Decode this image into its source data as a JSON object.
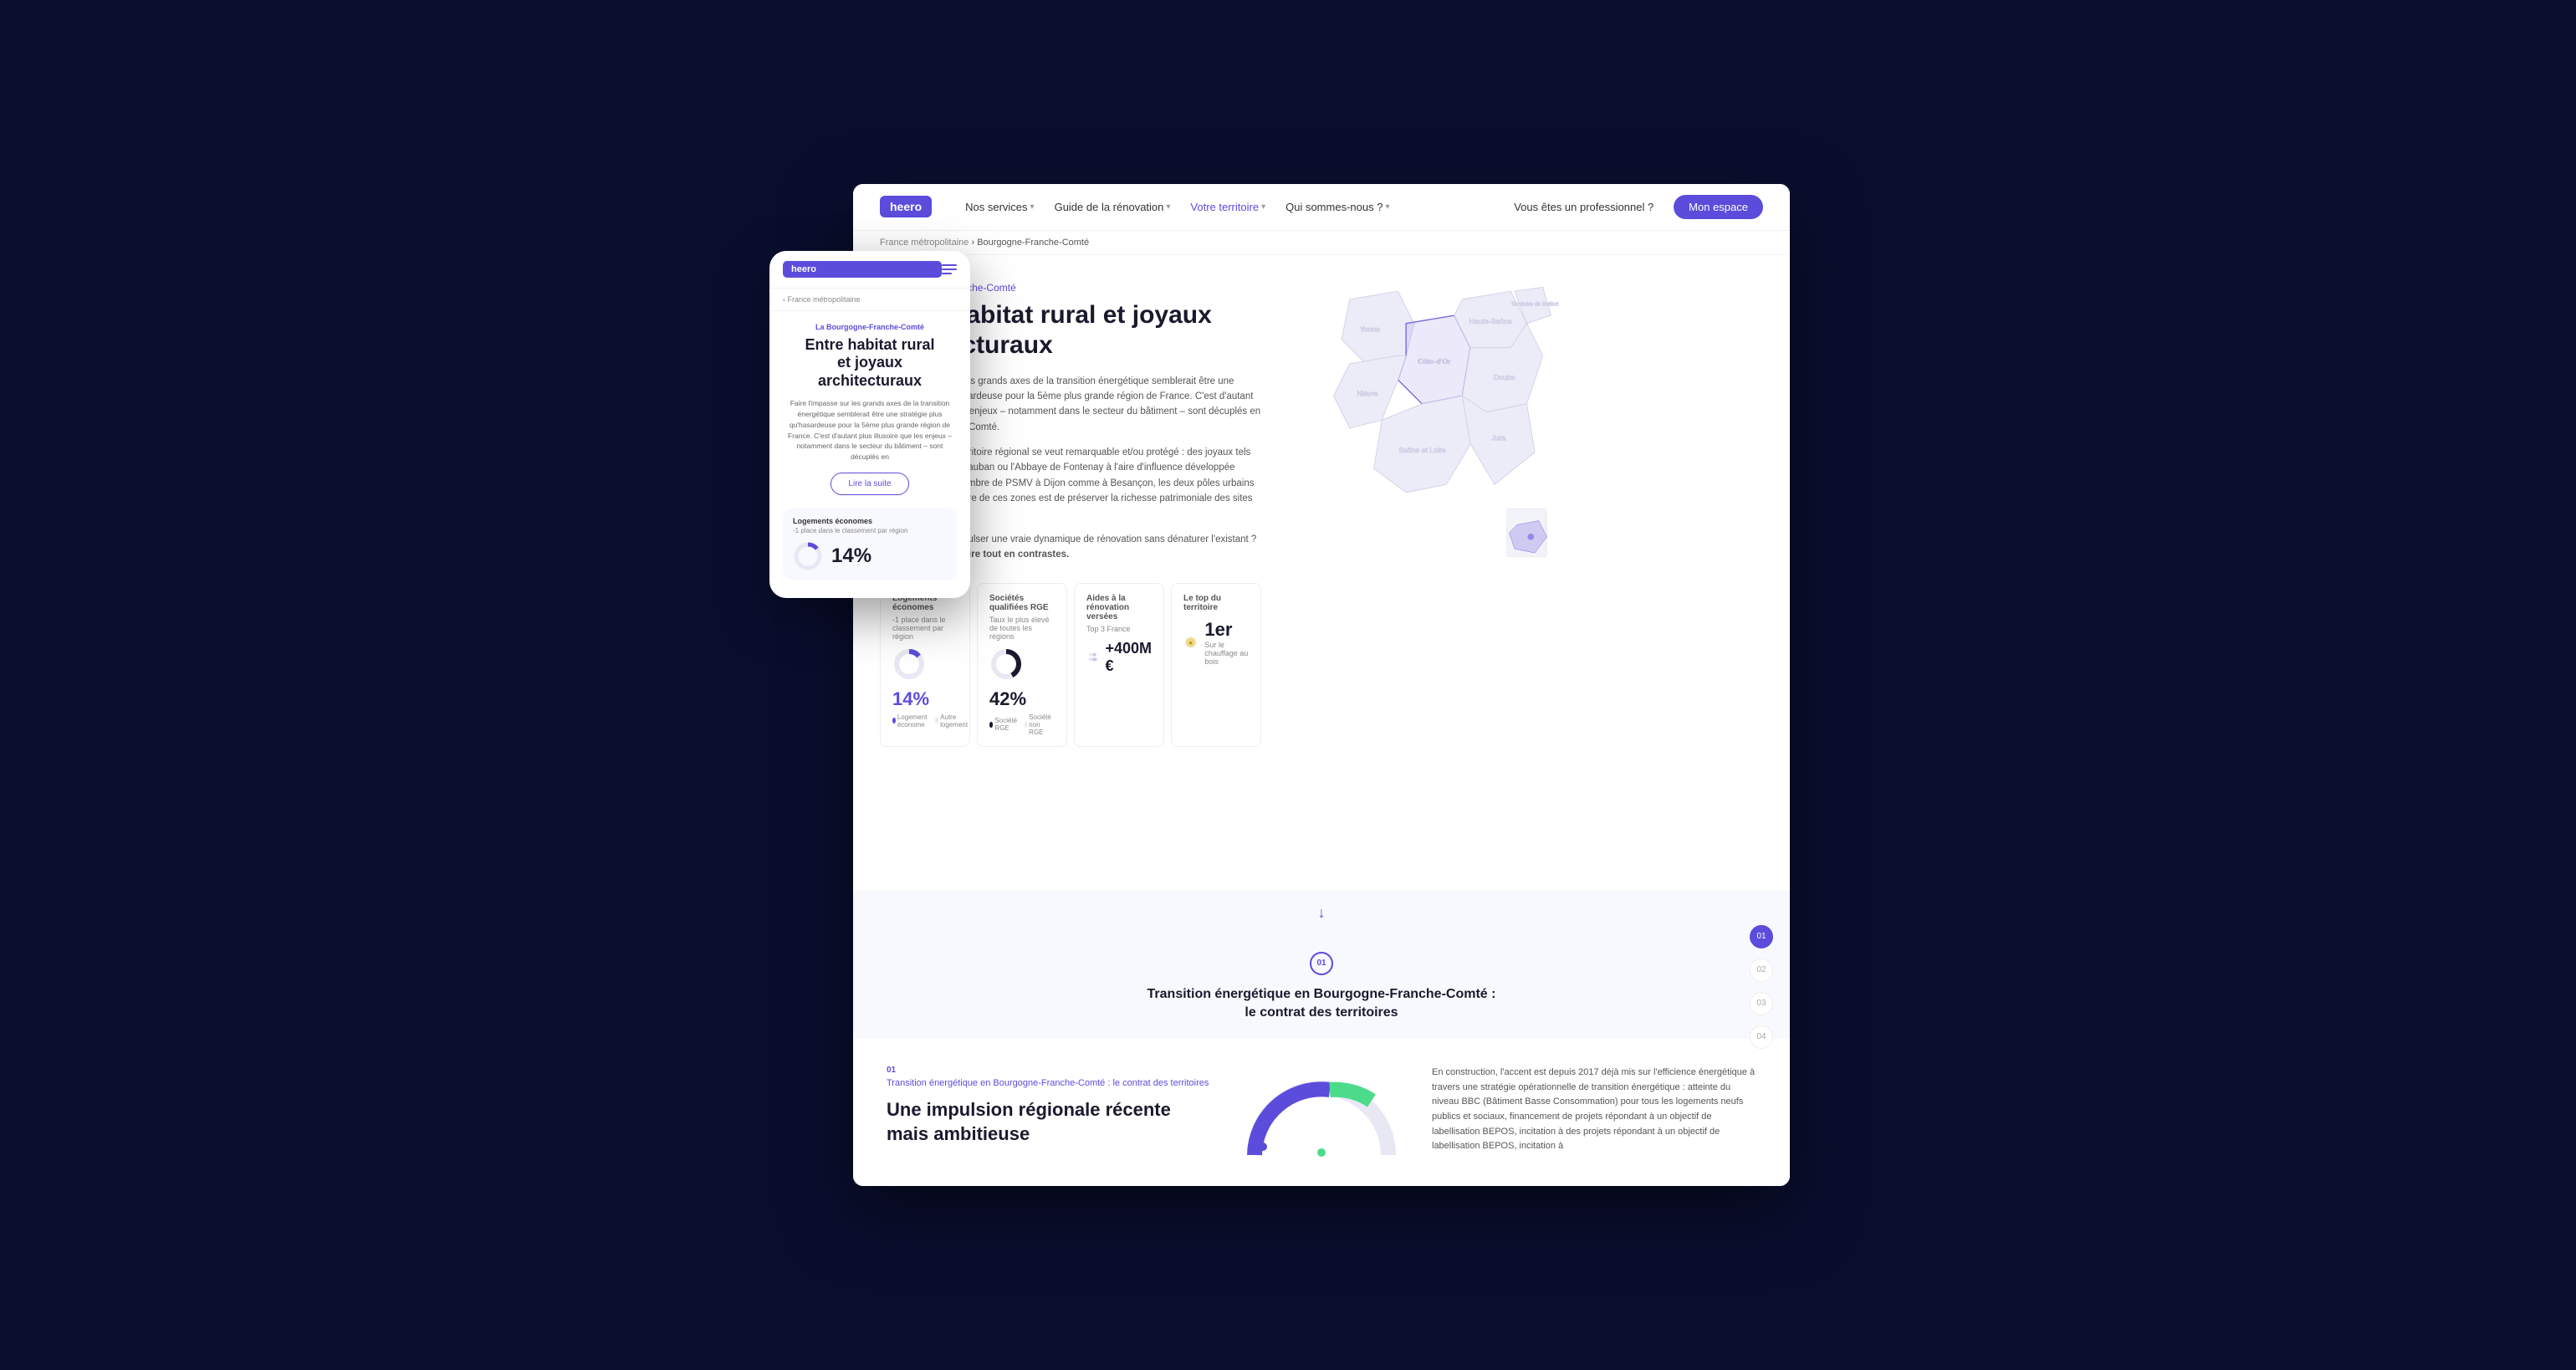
{
  "background_color": "#0a0e2e",
  "desktop": {
    "nav": {
      "logo": "heero",
      "items": [
        {
          "label": "Nos services",
          "has_dropdown": true,
          "active": false
        },
        {
          "label": "Guide de la rénovation",
          "has_dropdown": true,
          "active": false
        },
        {
          "label": "Votre territoire",
          "has_dropdown": true,
          "active": true
        },
        {
          "label": "Qui sommes-nous ?",
          "has_dropdown": true,
          "active": false
        }
      ],
      "pro_label": "Vous êtes un professionnel ?",
      "space_label": "Mon espace"
    },
    "breadcrumb": {
      "parent": "France métropolitaine",
      "current": "Bourgogne-Franche-Comté",
      "separator": "›"
    },
    "article": {
      "region_label": "La Bourgogne-Franche-Comté",
      "title": "Entre habitat rural et joyaux architecturaux",
      "body1": "Faire l'impasse sur les grands axes de la transition énergétique semblerait être une stratégie plus qu'hasardeuse pour la 5ème plus grande région de France. C'est d'autant plus illusoire que les enjeux – notamment dans le secteur du bâtiment – sont décuplés en Bourgogne-Franche-Comté.",
      "body2": "Près d'un tiers du territoire régional se veut remarquable et/ou protégé : des joyaux tels que la Citadelle de Vauban ou l'Abbaye de Fontenay à l'aire d'influence développée côtoient un grand nombre de PSMV à Dijon comme à Besançon, les deux pôles urbains de la région. Le propre de ces zones est de préserver la richesse patrimoniale des sites qui le composent.",
      "body3": "Mais comment y impulser une vraie dynamique de rénovation sans dénaturer l'existant ? Zoom sur un territoire tout en contrastes."
    },
    "stats": [
      {
        "label": "Logements économes",
        "sublabel": "-1 place dans le classement par région",
        "value": "14%",
        "type": "donut",
        "legend": [
          "Logement économe",
          "Autre logement"
        ],
        "colors": [
          "#5b4cdb",
          "#e8e8f5"
        ]
      },
      {
        "label": "Sociétés qualifiées RGE",
        "sublabel": "Taux le plus élevé de toutes les régions",
        "value": "42%",
        "type": "donut",
        "legend": [
          "Société RGE",
          "Société non RGE"
        ],
        "colors": [
          "#1a1a2e",
          "#e8e8f5"
        ]
      },
      {
        "label": "Aides à la rénovation versées",
        "sublabel": "Top 3 France",
        "value": "+400M €",
        "type": "icon"
      },
      {
        "label": "Le top du territoire",
        "value": "1er",
        "sublabel": "Sur le chauffage au bois",
        "type": "badge"
      }
    ],
    "sections": {
      "arrow_indicator": "↓",
      "section_number": "01",
      "section_title": "Transition énergétique en Bourgogne-Franche-Comté :\nle contrat des territoires"
    },
    "sidebar_numbers": [
      "01",
      "02",
      "03",
      "04"
    ],
    "bottom": {
      "section_num": "01",
      "section_sub": "Transition énergétique en Bourgogne-Franche-Comté : le contrat des territoires",
      "section_title": "Une impulsion régionale récente mais ambitieuse",
      "right_text": "En construction, l'accent est depuis 2017 déjà mis sur l'efficience énergétique à travers une stratégie opérationnelle de transition énergétique : atteinte du niveau BBC (Bâtiment Basse Consommation) pour tous les logements neufs publics et sociaux, financement de projets répondant à un objectif de labellisation BEPOS, incitation à des projets répondant à un objectif de labellisation BEPOS, incitation à"
    }
  },
  "mobile": {
    "logo": "heero",
    "breadcrumb": "‹ France métropolitaine",
    "region_label": "La Bourgogne-Franche-Comté",
    "title": "Entre habitat rural\net joyaux\narchitecturaux",
    "body": "Faire l'impasse sur les grands axes de la transition énergétique semblerait être une stratégie plus qu'hasardeuse pour la 5ème plus grande région de France. C'est d'autant plus illusoire que les enjeux – notamment dans le secteur du bâtiment – sont décuplés en",
    "read_more_label": "Lire la suite",
    "stat_card": {
      "label": "Logements économes",
      "sublabel": "-1 place dans le classement par région",
      "value": "14%"
    }
  },
  "map": {
    "regions": [
      "Yonne",
      "Territoire de Belfort",
      "Haute-Saône",
      "Côte-d'Or",
      "Nièvre",
      "Doubs",
      "Jura",
      "Saône et Loire"
    ]
  }
}
